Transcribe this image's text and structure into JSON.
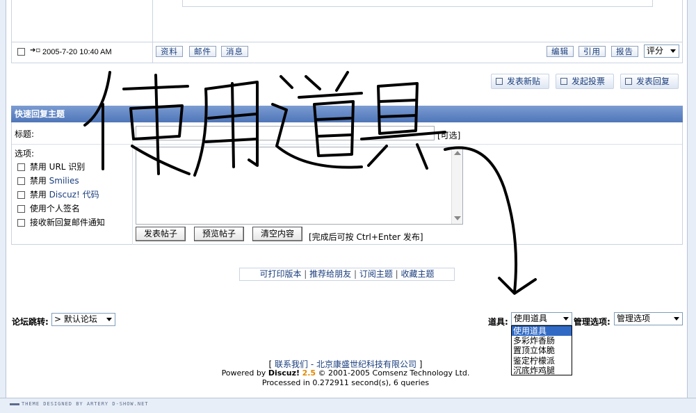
{
  "post": {
    "timestamp": "2005-7-20 10:40 AM",
    "left_buttons": [
      "资料",
      "邮件",
      "消息"
    ],
    "right_buttons": [
      "编辑",
      "引用",
      "报告"
    ],
    "rate_select": "评分"
  },
  "actions": {
    "new_post": "发表新贴",
    "new_poll": "发起投票",
    "reply": "发表回复"
  },
  "quick_reply": {
    "header": "快速回复主题",
    "title_label": "标题:",
    "title_hint": "[可选]",
    "options_label": "选项:",
    "options": [
      {
        "prefix": "禁用 ",
        "highlight": "",
        "text": "URL 识别"
      },
      {
        "prefix": "禁用 ",
        "highlight": "Smilies",
        "text": ""
      },
      {
        "prefix": "禁用 ",
        "highlight": "Discuz! 代码",
        "text": ""
      },
      {
        "prefix": "",
        "highlight": "",
        "text": "使用个人签名"
      },
      {
        "prefix": "",
        "highlight": "",
        "text": "接收新回复邮件通知"
      }
    ],
    "buttons": {
      "submit": "发表帖子",
      "preview": "预览帖子",
      "clear": "清空内容"
    },
    "submit_hint": "[完成后可按 Ctrl+Enter 发布]"
  },
  "links_bar": {
    "printable": "可打印版本",
    "recommend": "推荐给朋友",
    "subscribe": "订阅主题",
    "favorite": "收藏主题",
    "separator": " | "
  },
  "forum_jump": {
    "label": "论坛跳转:",
    "value": "> 默认论坛"
  },
  "tools": {
    "label": "道具:",
    "value": "使用道具",
    "options": [
      "使用道具",
      "多彩炸香肠",
      "置顶立体脆",
      "鉴定柠檬派",
      "沉底炸鸡腿"
    ]
  },
  "admin": {
    "label": "管理选项:",
    "value": "管理选项"
  },
  "footer": {
    "contact_open": "[ ",
    "contact": "联系我们",
    "company": " - 北京康盛世纪科技有限公司",
    "contact_close": " ]",
    "powered_prefix": "Powered by ",
    "brand": "Discuz!",
    "version": "2.5",
    "copyright": " © 2001-2005 Comsenz Technology Ltd.",
    "processed": "Processed in 0.272911 second(s), 6 queries"
  },
  "theme_credit": "THEME DESIGNED BY ARTERY D-SHOW.NET",
  "annotation": "使用道具",
  "colors": {
    "header_blue": "#5b80bf",
    "link_blue": "#1a3d7c",
    "selected": "#316ac5",
    "brand_orange": "#e08a00"
  }
}
